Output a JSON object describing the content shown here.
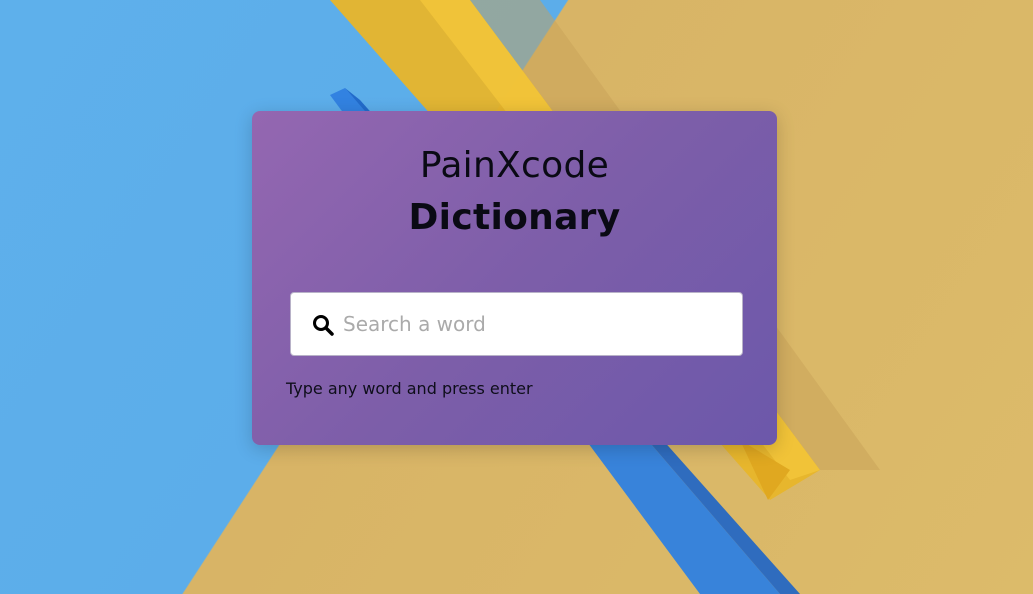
{
  "app": {
    "title_line1": "PainXcode",
    "title_line2": "Dictionary"
  },
  "search": {
    "placeholder": "Search a word",
    "value": "",
    "icon": "search-icon"
  },
  "hint": "Type any word and press enter",
  "colors": {
    "card_gradient_start": "#9467b1",
    "card_gradient_end": "#6c58aa",
    "background_blue": "#5eb0eb",
    "background_yellow": "#dcbb6a",
    "text": "#0a0a14"
  }
}
